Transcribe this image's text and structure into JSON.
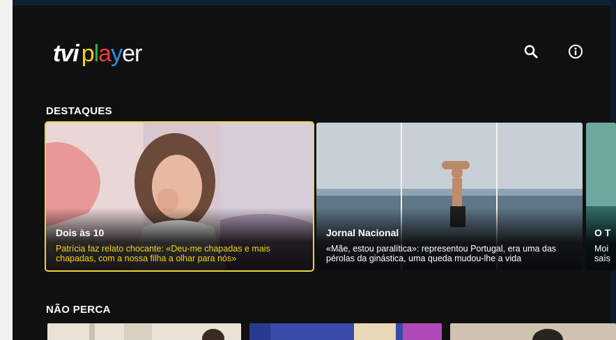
{
  "header": {
    "logo_tvi": "tvi",
    "logo_player": [
      "p",
      "l",
      "a",
      "y",
      "e",
      "r"
    ],
    "search_icon": "search-icon",
    "info_icon": "info-icon"
  },
  "sections": {
    "destaques": {
      "title": "DESTAQUES",
      "cards": [
        {
          "title": "Dois às 10",
          "description": "Patrícia faz relato chocante: «Deu-me chapadas e mais chapadas, com a nossa filha a olhar para nós»",
          "focused": true
        },
        {
          "title": "Jornal Nacional",
          "description": "«Mãe, estou paralítica»: representou Portugal, era uma das pérolas da ginástica, uma queda mudou-lhe a vida",
          "focused": false
        },
        {
          "title": "O T",
          "description": "Moi saís",
          "focused": false
        }
      ]
    },
    "nao_perca": {
      "title": "NÃO PERCA"
    }
  },
  "colors": {
    "background": "#101010",
    "focus_outline": "#f0d43a",
    "focus_text": "#f4d21e"
  }
}
